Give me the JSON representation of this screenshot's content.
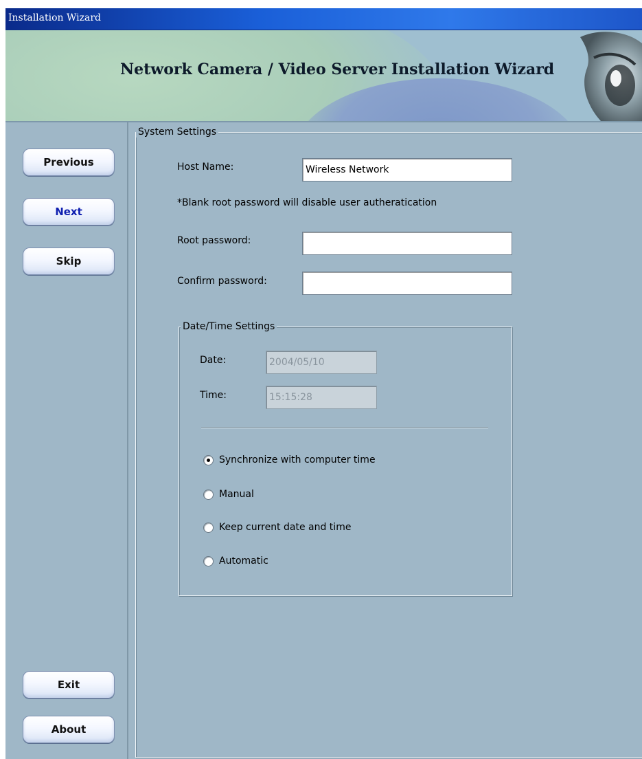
{
  "window": {
    "title": "Installation Wizard"
  },
  "banner": {
    "heading": "Network Camera / Video Server Installation Wizard"
  },
  "sidebar": {
    "previous": "Previous",
    "next": "Next",
    "skip": "Skip",
    "exit": "Exit",
    "about": "About"
  },
  "system_settings": {
    "legend": "System Settings",
    "host_name_label": "Host Name:",
    "host_name_value": "Wireless Network",
    "note": "*Blank root password will disable user autheratication",
    "root_password_label": "Root password:",
    "root_password_value": "",
    "confirm_password_label": "Confirm password:",
    "confirm_password_value": ""
  },
  "datetime_settings": {
    "legend": "Date/Time Settings",
    "date_label": "Date:",
    "date_value": "2004/05/10",
    "time_label": "Time:",
    "time_value": "15:15:28",
    "options": [
      {
        "label": "Synchronize with computer time",
        "checked": true
      },
      {
        "label": "Manual",
        "checked": false
      },
      {
        "label": "Keep current date and time",
        "checked": false
      },
      {
        "label": "Automatic",
        "checked": false
      }
    ]
  },
  "colors": {
    "background": "#9fb7c7",
    "titlebar": "#1a5fd8",
    "active_button_text": "#1020b0"
  }
}
